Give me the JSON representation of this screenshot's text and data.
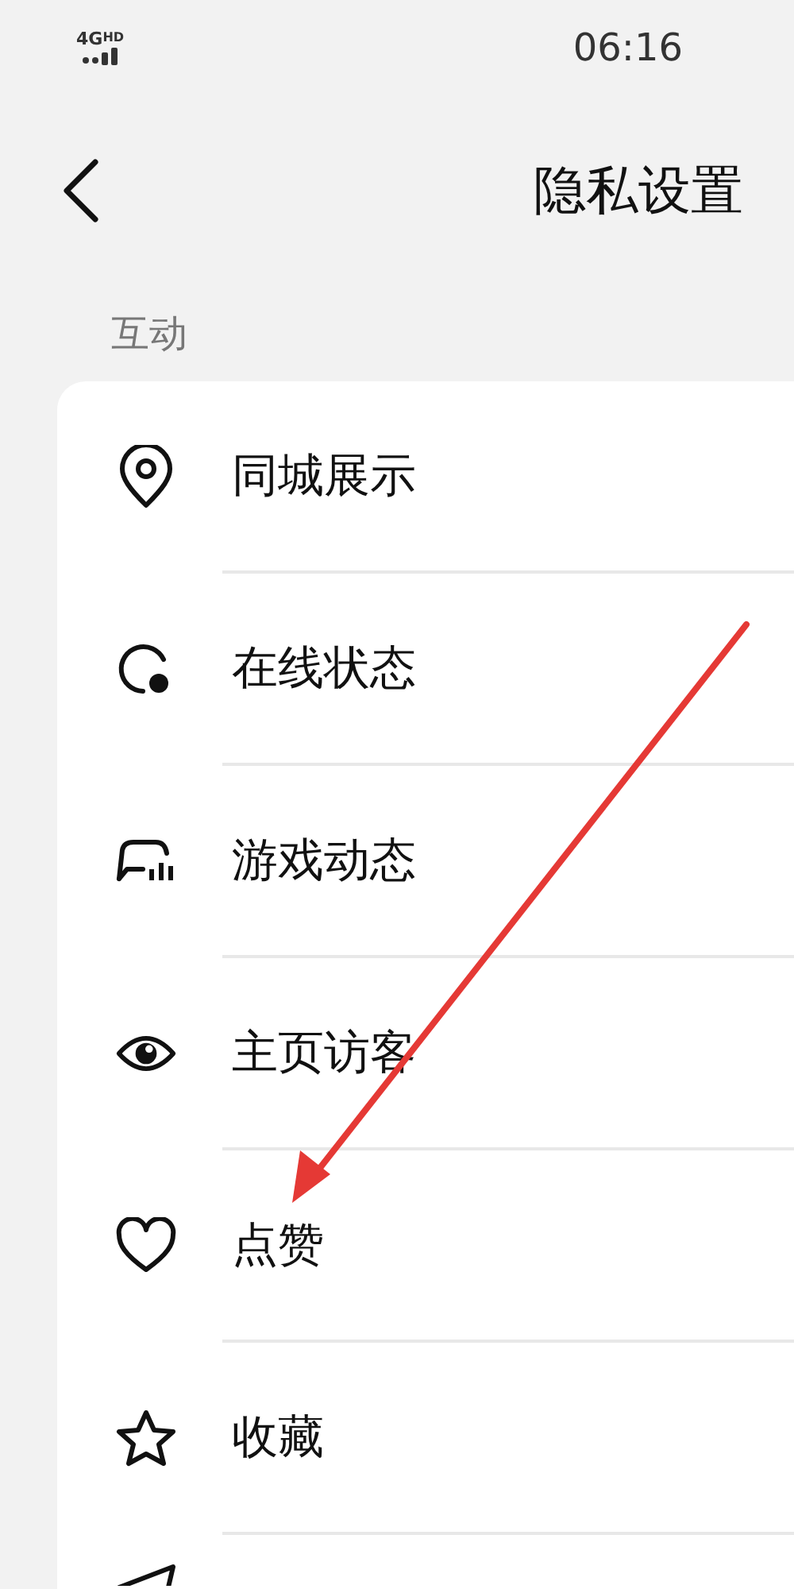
{
  "status_bar": {
    "network": "4G",
    "network_badge": "HD",
    "time": "06:16"
  },
  "header": {
    "title": "隐私设置"
  },
  "section": {
    "title": "互动"
  },
  "items": [
    {
      "label": "同城展示"
    },
    {
      "label": "在线状态"
    },
    {
      "label": "游戏动态"
    },
    {
      "label": "主页访客"
    },
    {
      "label": "点赞"
    },
    {
      "label": "收藏"
    }
  ]
}
